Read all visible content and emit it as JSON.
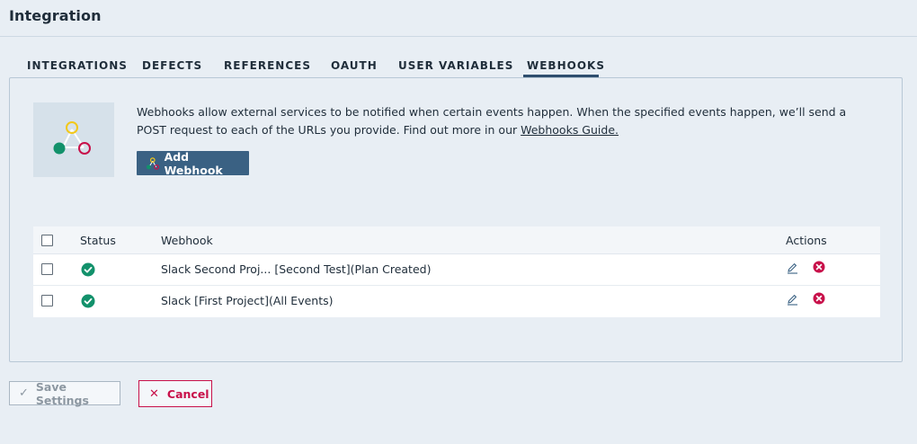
{
  "header": {
    "title": "Integration"
  },
  "tabs": [
    {
      "label": "INTEGRATIONS"
    },
    {
      "label": "DEFECTS"
    },
    {
      "label": "REFERENCES"
    },
    {
      "label": "OAUTH"
    },
    {
      "label": "USER VARIABLES"
    },
    {
      "label": "WEBHOOKS",
      "active": true
    }
  ],
  "webhooks": {
    "description": "Webhooks allow external services to be notified when certain events happen. When the specified events happen, we’ll send a POST request to each of the URLs you provide. Find out more in our ",
    "guide_link": "Webhooks Guide.",
    "add_button": "Add Webhook",
    "table": {
      "headers": {
        "status": "Status",
        "webhook": "Webhook",
        "actions": "Actions"
      },
      "rows": [
        {
          "status": "active",
          "webhook": "Slack Second Proj... [Second Test](Plan Created)"
        },
        {
          "status": "active",
          "webhook": "Slack [First Project](All Events)"
        }
      ]
    }
  },
  "footer": {
    "save_label": "Save Settings",
    "cancel_label": "Cancel"
  },
  "colors": {
    "primary_button": "#3a6183",
    "status_green": "#12916b",
    "delete_red": "#c8114a",
    "illustration_yellow": "#f2c81a"
  }
}
